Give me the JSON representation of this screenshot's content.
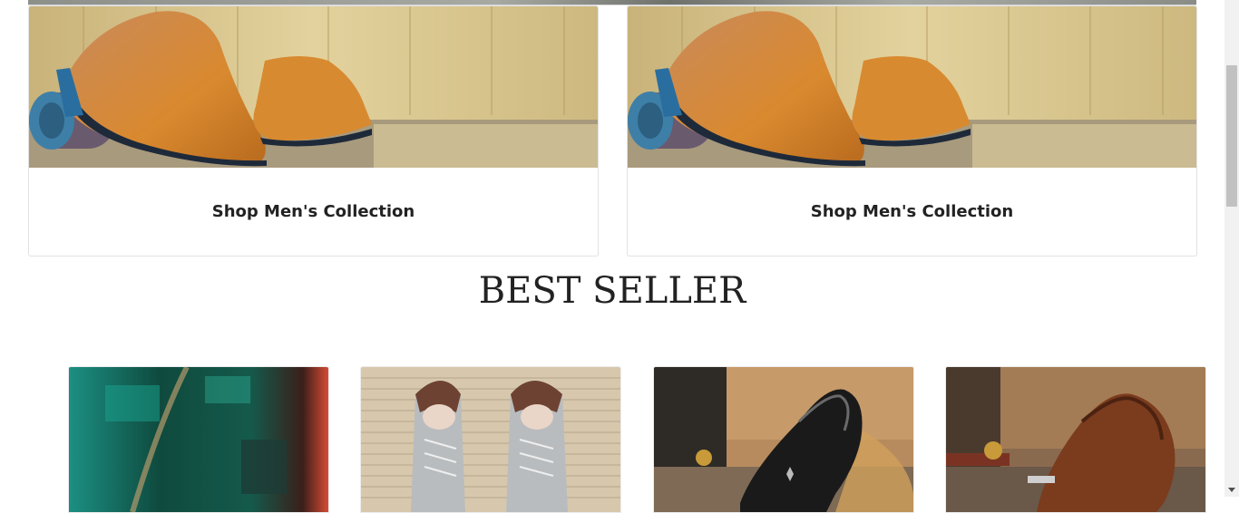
{
  "promos": [
    {
      "caption": "Shop Men's Collection"
    },
    {
      "caption": "Shop Men's Collection"
    }
  ],
  "best_seller": {
    "title": "BEST SELLER"
  },
  "products": [
    {
      "image": "blurred-product-image"
    },
    {
      "image": "grey-oxford-shoes-image"
    },
    {
      "image": "black-patent-shoe-image"
    },
    {
      "image": "brown-loafer-image"
    }
  ],
  "colors": {
    "text": "#222222",
    "background": "#ffffff",
    "card_border": "#e2e2e2"
  }
}
